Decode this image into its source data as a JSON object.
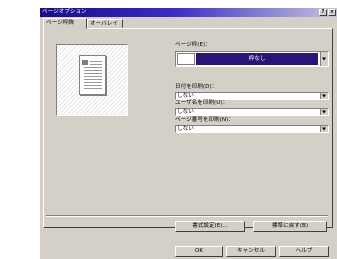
{
  "window": {
    "title": "ページオプション",
    "help_btn": "?",
    "close_btn": "×"
  },
  "tabs": [
    {
      "label": "ページ枠飾"
    },
    {
      "label": "オーバレイ"
    }
  ],
  "fields": {
    "page_frame": {
      "label": "ページ枠(E)：",
      "value": "枠なし"
    },
    "print_date": {
      "label": "日付を印刷(D)：",
      "value": "しない"
    },
    "print_username": {
      "label": "ユーザ名を印刷(U)：",
      "value": "しない"
    },
    "print_page_number": {
      "label": "ページ番号を印刷(N)：",
      "value": "しない"
    }
  },
  "buttons": {
    "format_settings": "書式設定(E)...",
    "restore_default": "標準に戻す(B)",
    "ok": "OK",
    "cancel": "キャンセル",
    "help": "ヘルプ"
  }
}
